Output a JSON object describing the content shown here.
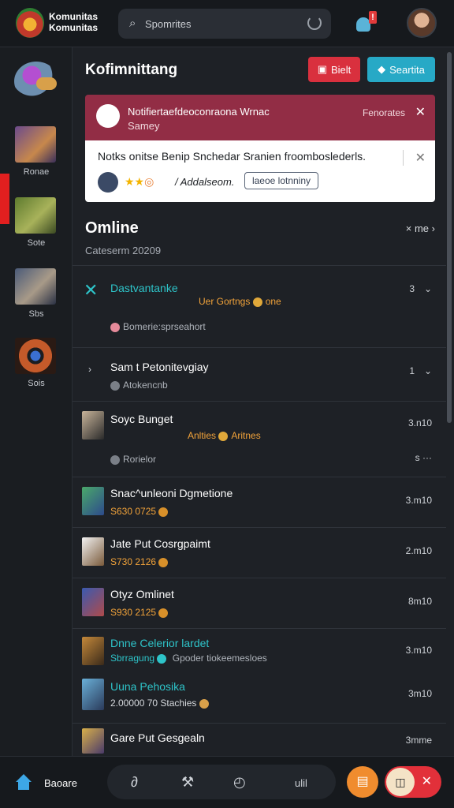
{
  "app": {
    "brand": "Komunitas Komunitas"
  },
  "search": {
    "text": "Spomrites"
  },
  "rail": {
    "items": [
      {
        "label": "Ronae"
      },
      {
        "label": "Sote"
      },
      {
        "label": "Sbs"
      },
      {
        "label": "Sois"
      }
    ]
  },
  "main": {
    "title": "Kofimnittang",
    "btn_red": "Bielt",
    "btn_teal": "Seartita"
  },
  "banner": {
    "title": "Notifiertaefdeoconraona Wrnac",
    "sub": "Samey",
    "right": "Fenorates"
  },
  "notice": {
    "text": "Notks onitse Benip Snchedar Sranien froomboslederls.",
    "link": "/ Addalseom.",
    "button": "laeoe lotnniny"
  },
  "section": {
    "title": "Omline",
    "sub": "Cateserm 20209",
    "more": "× me"
  },
  "rows": [
    {
      "name": "Dastvantanke",
      "extra": "Uer Gortngs",
      "extra2": "one",
      "meta": "Bomerie:sprseahort",
      "right": "3"
    },
    {
      "name": "Sam t Petonitevgiay",
      "meta": "Atokencnb",
      "right": "1"
    },
    {
      "name": "Soyc Bunget",
      "extra": "Anlties",
      "extra2": "Aritnes",
      "meta": "Rorielor",
      "right": "3.n10",
      "right2": "s ···"
    },
    {
      "name": "Snac^unleoni Dgmetione",
      "meta": "S630 0725",
      "right": "3.m10"
    },
    {
      "name": "Jate Put Cosrgpaimt",
      "meta": "S730 2126",
      "right": "2.m10"
    },
    {
      "name": "Otyz Omlinet",
      "meta": "S930 2125",
      "right": "8m10"
    },
    {
      "name": "Dnne Celerior lardet",
      "meta": "Sbrragung",
      "extra": "Gpoder tiokeemesloes",
      "right": "3.m10"
    },
    {
      "name": "Uuna Pehosika",
      "meta": "2.00000 70 Stachies",
      "right": "3m10"
    },
    {
      "name": "Gare Put Gesgealn",
      "right": "3mme"
    }
  ],
  "bottom": {
    "home": "Baoare",
    "nav4": "ulil"
  },
  "colors": {
    "accent": "#27a9c6",
    "danger": "#d9303e",
    "banner": "#922d45",
    "orange": "#f2a33a"
  }
}
